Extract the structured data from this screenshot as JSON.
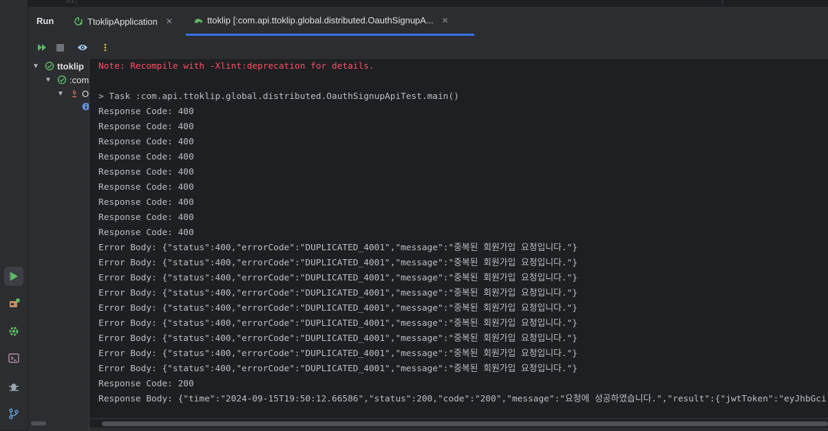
{
  "editor": {
    "line_number": "31"
  },
  "tool_window": {
    "title": "Run",
    "tabs": [
      {
        "label": "TtoklipApplication",
        "icon": "spring-boot-run-icon"
      },
      {
        "label": "ttoklip [:com.api.ttoklip.global.distributed.OauthSignupA...",
        "icon": "gradle-elephant-icon",
        "selected": true
      }
    ]
  },
  "toolbar": {
    "rerun_icon": "rerun-failed-icon",
    "stop_icon": "stop-icon",
    "view_icon": "eye-icon",
    "more_icon": "kebab-menu-icon"
  },
  "tree": {
    "items": [
      {
        "label": "ttoklip",
        "status": "success-icon"
      },
      {
        "label": ":com",
        "status": "success-icon"
      },
      {
        "label": "O",
        "status": "java-icon"
      }
    ]
  },
  "console": {
    "lines": [
      {
        "text": "Note: Recompile with -Xlint:deprecation for details.",
        "style": "warn"
      },
      {
        "text": "",
        "style": "normal"
      },
      {
        "text": "> Task :com.api.ttoklip.global.distributed.OauthSignupApiTest.main()",
        "style": "normal"
      },
      {
        "text": "Response Code: 400",
        "style": "normal"
      },
      {
        "text": "Response Code: 400",
        "style": "normal"
      },
      {
        "text": "Response Code: 400",
        "style": "normal"
      },
      {
        "text": "Response Code: 400",
        "style": "normal"
      },
      {
        "text": "Response Code: 400",
        "style": "normal"
      },
      {
        "text": "Response Code: 400",
        "style": "normal"
      },
      {
        "text": "Response Code: 400",
        "style": "normal"
      },
      {
        "text": "Response Code: 400",
        "style": "normal"
      },
      {
        "text": "Response Code: 400",
        "style": "normal"
      },
      {
        "text": "Error Body: {\"status\":400,\"errorCode\":\"DUPLICATED_4001\",\"message\":\"중복된 회원가입 요청입니다.\"}",
        "style": "normal"
      },
      {
        "text": "Error Body: {\"status\":400,\"errorCode\":\"DUPLICATED_4001\",\"message\":\"중복된 회원가입 요청입니다.\"}",
        "style": "normal"
      },
      {
        "text": "Error Body: {\"status\":400,\"errorCode\":\"DUPLICATED_4001\",\"message\":\"중복된 회원가입 요청입니다.\"}",
        "style": "normal"
      },
      {
        "text": "Error Body: {\"status\":400,\"errorCode\":\"DUPLICATED_4001\",\"message\":\"중복된 회원가입 요청입니다.\"}",
        "style": "normal"
      },
      {
        "text": "Error Body: {\"status\":400,\"errorCode\":\"DUPLICATED_4001\",\"message\":\"중복된 회원가입 요청입니다.\"}",
        "style": "normal"
      },
      {
        "text": "Error Body: {\"status\":400,\"errorCode\":\"DUPLICATED_4001\",\"message\":\"중복된 회원가입 요청입니다.\"}",
        "style": "normal"
      },
      {
        "text": "Error Body: {\"status\":400,\"errorCode\":\"DUPLICATED_4001\",\"message\":\"중복된 회원가입 요청입니다.\"}",
        "style": "normal"
      },
      {
        "text": "Error Body: {\"status\":400,\"errorCode\":\"DUPLICATED_4001\",\"message\":\"중복된 회원가입 요청입니다.\"}",
        "style": "normal"
      },
      {
        "text": "Error Body: {\"status\":400,\"errorCode\":\"DUPLICATED_4001\",\"message\":\"중복된 회원가입 요청입니다.\"}",
        "style": "normal"
      },
      {
        "text": "Response Code: 200",
        "style": "normal"
      },
      {
        "text": "Response Body: {\"time\":\"2024-09-15T19:50:12.66586\",\"status\":200,\"code\":\"200\",\"message\":\"요청에 성공하였습니다.\",\"result\":{\"jwtToken\":\"eyJhbGci",
        "style": "normal"
      }
    ]
  },
  "sidebar_icons": [
    "run-icon",
    "services-icon",
    "settings-icon",
    "terminal-icon",
    "problems-icon",
    "git-branch-icon"
  ],
  "colors": {
    "accent": "#3574f0",
    "success": "#5fb865",
    "warning_text": "#f75464",
    "background": "#1e1f22",
    "panel": "#2b2d30"
  }
}
